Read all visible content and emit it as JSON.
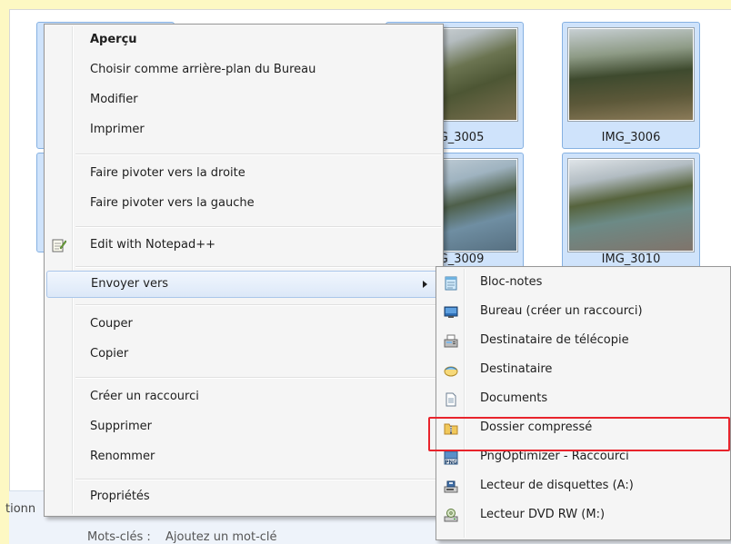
{
  "explorer": {
    "thumbnails": [
      {
        "caption": "",
        "top_visible": false
      },
      {
        "caption": "",
        "top_visible": false
      },
      {
        "caption": "IMG_3005"
      },
      {
        "caption": "IMG_3006"
      },
      {
        "caption": "IMG_3009"
      },
      {
        "caption": "IMG_3010"
      }
    ],
    "details": {
      "selection_fragment": "tionn",
      "keywords_label": "Mots-clés :",
      "keywords_value": "Ajoutez un mot-clé"
    }
  },
  "context_menu": {
    "preview": "Aperçu",
    "set_wallpaper": "Choisir comme arrière-plan du Bureau",
    "edit": "Modifier",
    "print": "Imprimer",
    "rotate_right": "Faire pivoter vers la droite",
    "rotate_left": "Faire pivoter vers la gauche",
    "notepad": "Edit with Notepad++",
    "send_to": "Envoyer vers",
    "cut": "Couper",
    "copy": "Copier",
    "create_shortcut": "Créer un raccourci",
    "delete": "Supprimer",
    "rename": "Renommer",
    "properties": "Propriétés"
  },
  "send_to_menu": {
    "notepad": "Bloc-notes",
    "desktop": "Bureau (créer un raccourci)",
    "fax": "Destinataire de télécopie",
    "mail": "Destinataire",
    "documents": "Documents",
    "zip": "Dossier compressé",
    "png_optimizer": "PngOptimizer - Raccourci",
    "floppy": "Lecteur de disquettes (A:)",
    "dvd": "Lecteur DVD RW (M:)"
  },
  "colors": {
    "background": "#fdf8c3",
    "highlight_border": "#e8242c",
    "selection": "#cfe3fb"
  }
}
